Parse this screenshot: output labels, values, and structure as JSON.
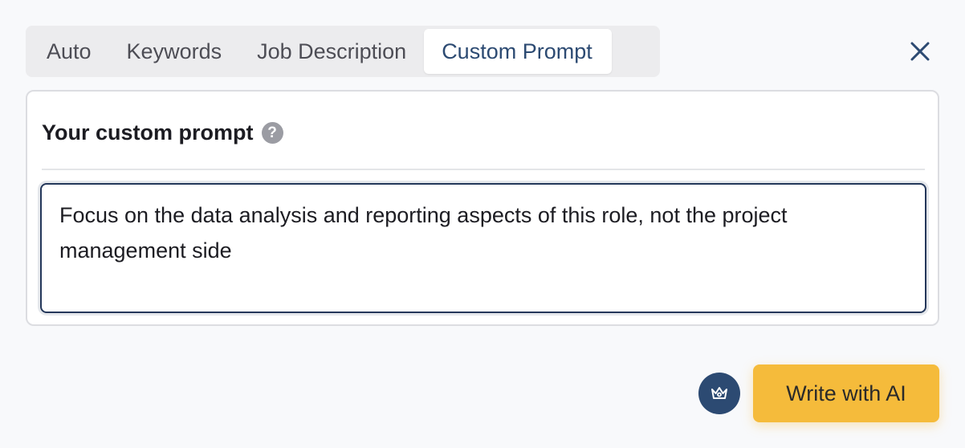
{
  "tabs": [
    {
      "label": "Auto"
    },
    {
      "label": "Keywords"
    },
    {
      "label": "Job Description"
    },
    {
      "label": "Custom Prompt",
      "active": true
    }
  ],
  "close_icon": "close-icon",
  "card": {
    "title": "Your custom prompt",
    "help_glyph": "?",
    "prompt_value": "Focus on the data analysis and reporting aspects of this role, not the project management side"
  },
  "footer": {
    "crown_icon": "crown-icon",
    "write_label": "Write with AI"
  },
  "colors": {
    "accent": "#2c4a72",
    "cta": "#f5bb3b",
    "tab_bg": "#ececee"
  }
}
